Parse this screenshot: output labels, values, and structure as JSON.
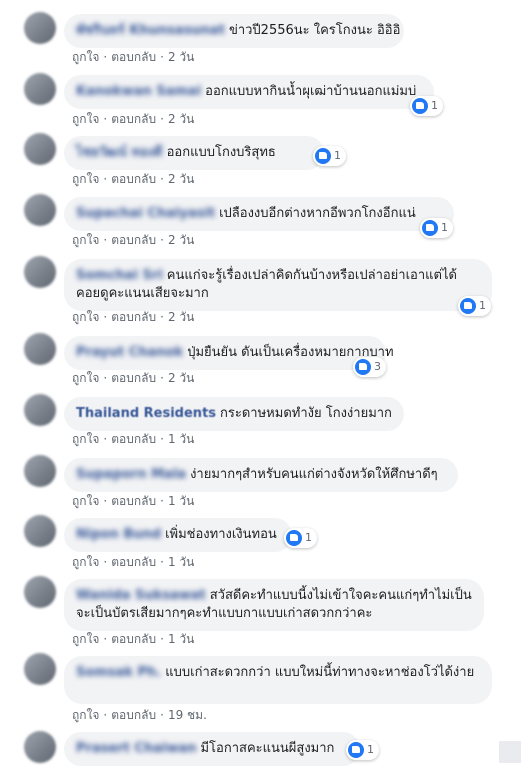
{
  "actions": {
    "like": "ถูกใจ",
    "reply": "ตอบกลับ",
    "separator": "·"
  },
  "comments": [
    {
      "author": "พัชรินทร์ Khunsasunat",
      "text": "ข่าวปี2556นะ ใครโกงนะ อิอิอิ",
      "time": "2 วัน",
      "reactions": ""
    },
    {
      "author": "Kanokwan Samai",
      "text": "ออกแบบหากินน้ำผุเฒ่าบ้านนอกแม่มบ่",
      "time": "2 วัน",
      "reactions": "1"
    },
    {
      "author": "ไชยวัฒน์ ทองดี",
      "text": "ออกแบบโกงบริสุทธ",
      "time": "2 วัน",
      "reactions": "1"
    },
    {
      "author": "Supachai Chaiyasit",
      "text": "เปลืองงบอีกต่างหากอีพวกโกงอีกแน่",
      "time": "2 วัน",
      "reactions": "1"
    },
    {
      "author": "Somchai Sri",
      "text": "คนแก่จะรู้เรื่องเปล่าคิดกันบ้างหรือเปล่าอย่าเอาแต่ได้คอยดูคะแนนเสียจะมาก",
      "time": "2 วัน",
      "reactions": "1"
    },
    {
      "author": "Prayut Chanok",
      "text": "ปุ่มยืนยัน ดันเป็นเครื่องหมายกากบาท",
      "time": "2 วัน",
      "reactions": "3"
    },
    {
      "author": "Thailand Residents",
      "text": "กระดาษหมดทำงัย โกงง่ายมาก",
      "time": "1 วัน",
      "reactions": ""
    },
    {
      "author": "Supaporn Mala",
      "text": "ง่ายมากๆสำหรับคนแก่ต่างจังหวัดให้ศึกษาดีๆ",
      "time": "1 วัน",
      "reactions": ""
    },
    {
      "author": "Nipon Bund",
      "text": "เพิ่มช่องทางเงินทอน",
      "time": "1 วัน",
      "reactions": "1"
    },
    {
      "author": "Wanida Suksawat",
      "text": "สวัสดีคะทำแบบนี้งไม่เข้าใจคะคนแก่ๆทำไม่เป็นจะเป็นบัตรเสียมากๆคะทำแบบกาแบบเก่าสดวกกว่าคะ",
      "time": "1 วัน",
      "reactions": ""
    },
    {
      "author": "Somsak Ph.",
      "text": "แบบเก่าสะดวกกว่า แบบใหม่นี้ท่าทางจะหาช่องโว่ได้ง่าย",
      "time": "19 ชม.",
      "reactions": ""
    },
    {
      "author": "Prasert Chaiwan",
      "text": "มีโอกาสคะแนนผีสูงมาก",
      "time": "",
      "reactions": "1"
    }
  ]
}
